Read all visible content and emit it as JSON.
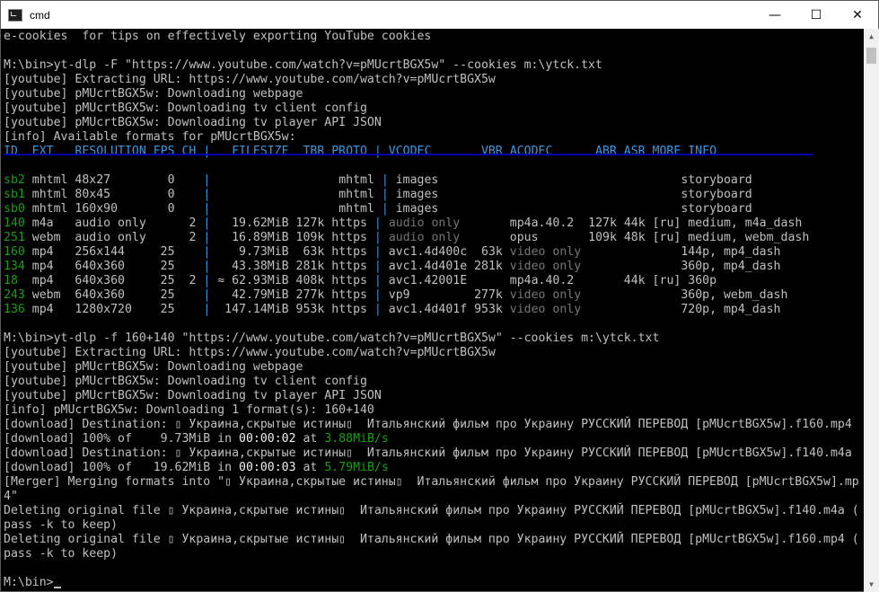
{
  "window": {
    "title": "cmd",
    "minimize_glyph": "—",
    "maximize_glyph": "☐",
    "close_glyph": "✕",
    "icon": "cmd-icon"
  },
  "scrollbar": {
    "up_arrow": "▲",
    "down_arrow": "▼",
    "position": 1.0
  },
  "console": {
    "lines": [
      {
        "segments": [
          {
            "t": "e-cookies  for tips on effectively exporting YouTube cookies"
          }
        ]
      },
      {
        "segments": [
          {
            "t": ""
          }
        ]
      },
      {
        "segments": [
          {
            "t": "M:\\bin>yt-dlp -F \"https://www.youtube.com/watch?v=pMUcrtBGX5w\" --cookies m:\\ytck.txt"
          }
        ]
      },
      {
        "segments": [
          {
            "t": "[youtube] Extracting URL: https://www.youtube.com/watch?v=pMUcrtBGX5w"
          }
        ]
      },
      {
        "segments": [
          {
            "t": "[youtube] pMUcrtBGX5w: Downloading webpage"
          }
        ]
      },
      {
        "segments": [
          {
            "t": "[youtube] pMUcrtBGX5w: Downloading tv client config"
          }
        ]
      },
      {
        "segments": [
          {
            "t": "[youtube] pMUcrtBGX5w: Downloading tv player API JSON"
          }
        ]
      },
      {
        "segments": [
          {
            "t": "[info] Available formats for pMUcrtBGX5w:"
          }
        ]
      },
      {
        "segments": [
          {
            "t": "ID  EXT   RESOLUTION FPS CH ",
            "c": "cyan"
          },
          {
            "t": "|",
            "c": "sep"
          },
          {
            "t": "   FILESIZE  TBR PROTO ",
            "c": "cyan"
          },
          {
            "t": "|",
            "c": "sep"
          },
          {
            "t": " VCODEC       VBR ACODEC      ABR ASR MORE INFO",
            "c": "cyan"
          }
        ]
      },
      {
        "segments": [
          {
            "t": ""
          }
        ]
      },
      {
        "segments": [
          {
            "t": "sb2",
            "c": "green"
          },
          {
            "t": " mhtml 48x27        0    "
          },
          {
            "t": "|",
            "c": "sep"
          },
          {
            "t": "                  mhtml "
          },
          {
            "t": "|",
            "c": "sep"
          },
          {
            "t": " images                                  storyboard"
          }
        ]
      },
      {
        "segments": [
          {
            "t": "sb1",
            "c": "green"
          },
          {
            "t": " mhtml 80x45        0    "
          },
          {
            "t": "|",
            "c": "sep"
          },
          {
            "t": "                  mhtml "
          },
          {
            "t": "|",
            "c": "sep"
          },
          {
            "t": " images                                  storyboard"
          }
        ]
      },
      {
        "segments": [
          {
            "t": "sb0",
            "c": "green"
          },
          {
            "t": " mhtml 160x90       0    "
          },
          {
            "t": "|",
            "c": "sep"
          },
          {
            "t": "                  mhtml "
          },
          {
            "t": "|",
            "c": "sep"
          },
          {
            "t": " images                                  storyboard"
          }
        ]
      },
      {
        "segments": [
          {
            "t": "140",
            "c": "green"
          },
          {
            "t": " m4a   audio only      2 "
          },
          {
            "t": "|",
            "c": "sep"
          },
          {
            "t": "   19.62MiB 127k https "
          },
          {
            "t": "|",
            "c": "sep"
          },
          {
            "t": " "
          },
          {
            "t": "audio only",
            "c": "gray"
          },
          {
            "t": "       mp4a.40.2  127k 44k [ru] medium, m4a_dash"
          }
        ]
      },
      {
        "segments": [
          {
            "t": "251",
            "c": "green"
          },
          {
            "t": " webm  audio only      2 "
          },
          {
            "t": "|",
            "c": "sep"
          },
          {
            "t": "   16.89MiB 109k https "
          },
          {
            "t": "|",
            "c": "sep"
          },
          {
            "t": " "
          },
          {
            "t": "audio only",
            "c": "gray"
          },
          {
            "t": "       opus       109k 48k [ru] medium, webm_dash"
          }
        ]
      },
      {
        "segments": [
          {
            "t": "160",
            "c": "green"
          },
          {
            "t": " mp4   256x144     25    "
          },
          {
            "t": "|",
            "c": "sep"
          },
          {
            "t": "    9.73MiB  63k https "
          },
          {
            "t": "|",
            "c": "sep"
          },
          {
            "t": " avc1.4d400c  63k "
          },
          {
            "t": "video only",
            "c": "gray"
          },
          {
            "t": "              144p, mp4_dash"
          }
        ]
      },
      {
        "segments": [
          {
            "t": "134",
            "c": "green"
          },
          {
            "t": " mp4   640x360     25    "
          },
          {
            "t": "|",
            "c": "sep"
          },
          {
            "t": "   43.38MiB 281k https "
          },
          {
            "t": "|",
            "c": "sep"
          },
          {
            "t": " avc1.4d401e 281k "
          },
          {
            "t": "video only",
            "c": "gray"
          },
          {
            "t": "              360p, mp4_dash"
          }
        ]
      },
      {
        "segments": [
          {
            "t": "18",
            "c": "green"
          },
          {
            "t": "  mp4   640x360     25  2 "
          },
          {
            "t": "|",
            "c": "sep"
          },
          {
            "t": " ≈ 62.93MiB 408k https "
          },
          {
            "t": "|",
            "c": "sep"
          },
          {
            "t": " avc1.42001E      mp4a.40.2       44k [ru] 360p"
          }
        ]
      },
      {
        "segments": [
          {
            "t": "243",
            "c": "green"
          },
          {
            "t": " webm  640x360     25    "
          },
          {
            "t": "|",
            "c": "sep"
          },
          {
            "t": "   42.79MiB 277k https "
          },
          {
            "t": "|",
            "c": "sep"
          },
          {
            "t": " vp9         277k "
          },
          {
            "t": "video only",
            "c": "gray"
          },
          {
            "t": "              360p, webm_dash"
          }
        ]
      },
      {
        "segments": [
          {
            "t": "136",
            "c": "green"
          },
          {
            "t": " mp4   1280x720    25    "
          },
          {
            "t": "|",
            "c": "sep"
          },
          {
            "t": "  147.14MiB 953k https "
          },
          {
            "t": "|",
            "c": "sep"
          },
          {
            "t": " avc1.4d401f 953k "
          },
          {
            "t": "video only",
            "c": "gray"
          },
          {
            "t": "              720p, mp4_dash"
          }
        ]
      },
      {
        "segments": [
          {
            "t": ""
          }
        ]
      },
      {
        "segments": [
          {
            "t": "M:\\bin>yt-dlp -f 160+140 \"https://www.youtube.com/watch?v=pMUcrtBGX5w\" --cookies m:\\ytck.txt"
          }
        ]
      },
      {
        "segments": [
          {
            "t": "[youtube] Extracting URL: https://www.youtube.com/watch?v=pMUcrtBGX5w"
          }
        ]
      },
      {
        "segments": [
          {
            "t": "[youtube] pMUcrtBGX5w: Downloading webpage"
          }
        ]
      },
      {
        "segments": [
          {
            "t": "[youtube] pMUcrtBGX5w: Downloading tv client config"
          }
        ]
      },
      {
        "segments": [
          {
            "t": "[youtube] pMUcrtBGX5w: Downloading tv player API JSON"
          }
        ]
      },
      {
        "segments": [
          {
            "t": "[info] pMUcrtBGX5w: Downloading 1 format(s): 160+140"
          }
        ]
      },
      {
        "segments": [
          {
            "t": "[download] Destination: ▯ Украина,скрытые истины▯  Итальянский фильм про Украину РУССКИЙ ПЕРЕВОД [pMUcrtBGX5w].f160.mp4"
          }
        ]
      },
      {
        "segments": [
          {
            "t": "[download] 100% of    9.73MiB in "
          },
          {
            "t": "00:00:02",
            "c": "white"
          },
          {
            "t": " at "
          },
          {
            "t": "3.88MiB/s",
            "c": "green"
          }
        ]
      },
      {
        "segments": [
          {
            "t": "[download] Destination: ▯ Украина,скрытые истины▯  Итальянский фильм про Украину РУССКИЙ ПЕРЕВОД [pMUcrtBGX5w].f140.m4a"
          }
        ]
      },
      {
        "segments": [
          {
            "t": "[download] 100% of   19.62MiB in "
          },
          {
            "t": "00:00:03",
            "c": "white"
          },
          {
            "t": " at "
          },
          {
            "t": "5.79MiB/s",
            "c": "green"
          }
        ]
      },
      {
        "segments": [
          {
            "t": "[Merger] Merging formats into \"▯ Украина,скрытые истины▯  Итальянский фильм про Украину РУССКИЙ ПЕРЕВОД [pMUcrtBGX5w].mp"
          }
        ]
      },
      {
        "segments": [
          {
            "t": "4\""
          }
        ]
      },
      {
        "segments": [
          {
            "t": "Deleting original file ▯ Украина,скрытые истины▯  Итальянский фильм про Украину РУССКИЙ ПЕРЕВОД [pMUcrtBGX5w].f140.m4a ("
          }
        ]
      },
      {
        "segments": [
          {
            "t": "pass -k to keep)"
          }
        ]
      },
      {
        "segments": [
          {
            "t": "Deleting original file ▯ Украина,скрытые истины▯  Итальянский фильм про Украину РУССКИЙ ПЕРЕВОД [pMUcrtBGX5w].f160.mp4 ("
          }
        ]
      },
      {
        "segments": [
          {
            "t": "pass -k to keep)"
          }
        ]
      },
      {
        "segments": [
          {
            "t": ""
          }
        ]
      },
      {
        "segments": [
          {
            "t": "M:\\bin>"
          }
        ],
        "cursor": true
      }
    ]
  }
}
